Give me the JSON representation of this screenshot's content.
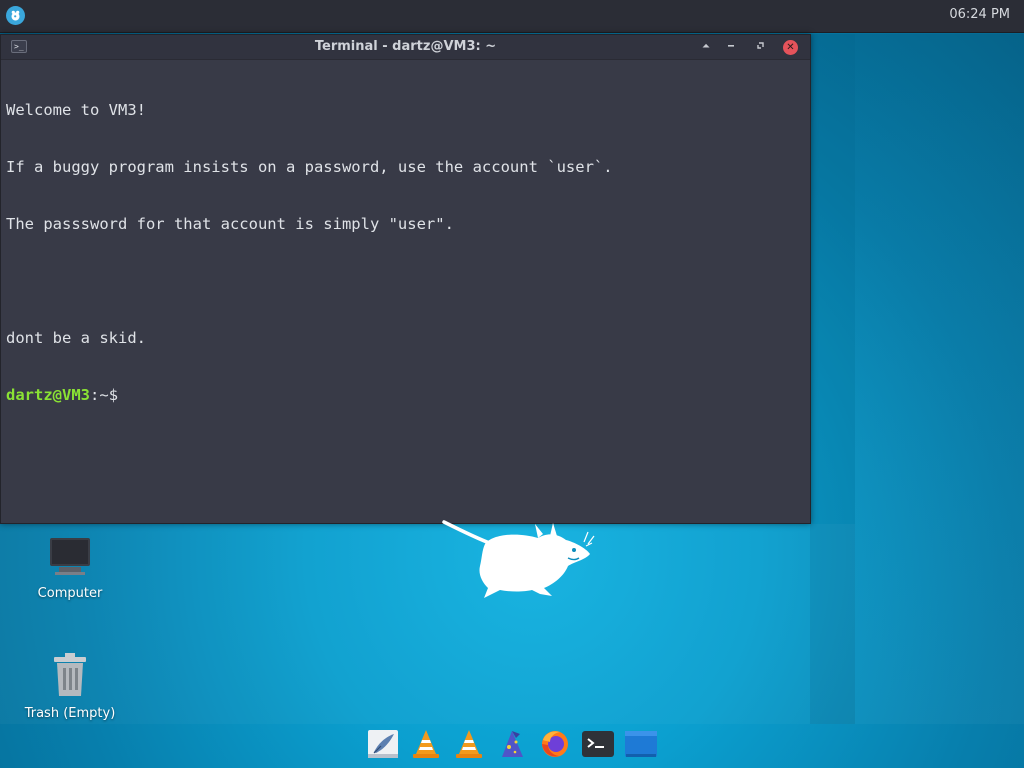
{
  "panel": {
    "clock": "06:24 PM",
    "menu_icon": "whisker-menu-icon"
  },
  "terminal": {
    "window_title": "Terminal - dartz@VM3: ~",
    "window_icon": "terminal-icon",
    "lines": [
      "Welcome to VM3!",
      "If a buggy program insists on a password, use the account `user`.",
      "The passsword for that account is simply \"user\".",
      "",
      "dont be a skid."
    ],
    "prompt": {
      "user_host": "dartz@VM3",
      "separator": ":",
      "path": "~",
      "symbol": "$"
    },
    "buttons": [
      "shade-icon",
      "minimize-icon",
      "maximize-icon",
      "close-icon"
    ]
  },
  "desktop_icons": [
    {
      "label": "Computer",
      "icon": "computer-icon"
    },
    {
      "label": "Trash (Empty)",
      "icon": "trash-icon"
    }
  ],
  "dock": {
    "items": [
      "feather-app-icon",
      "vlc-icon",
      "vlc-icon",
      "wizard-app-icon",
      "firefox-icon",
      "terminal-icon",
      "file-manager-icon"
    ]
  },
  "colors": {
    "terminal_bg": "#383a47",
    "titlebar_bg": "#31333f",
    "prompt_green": "#8ae234",
    "close_red": "#e5535b",
    "desktop_blue": "#0b9fcf"
  }
}
